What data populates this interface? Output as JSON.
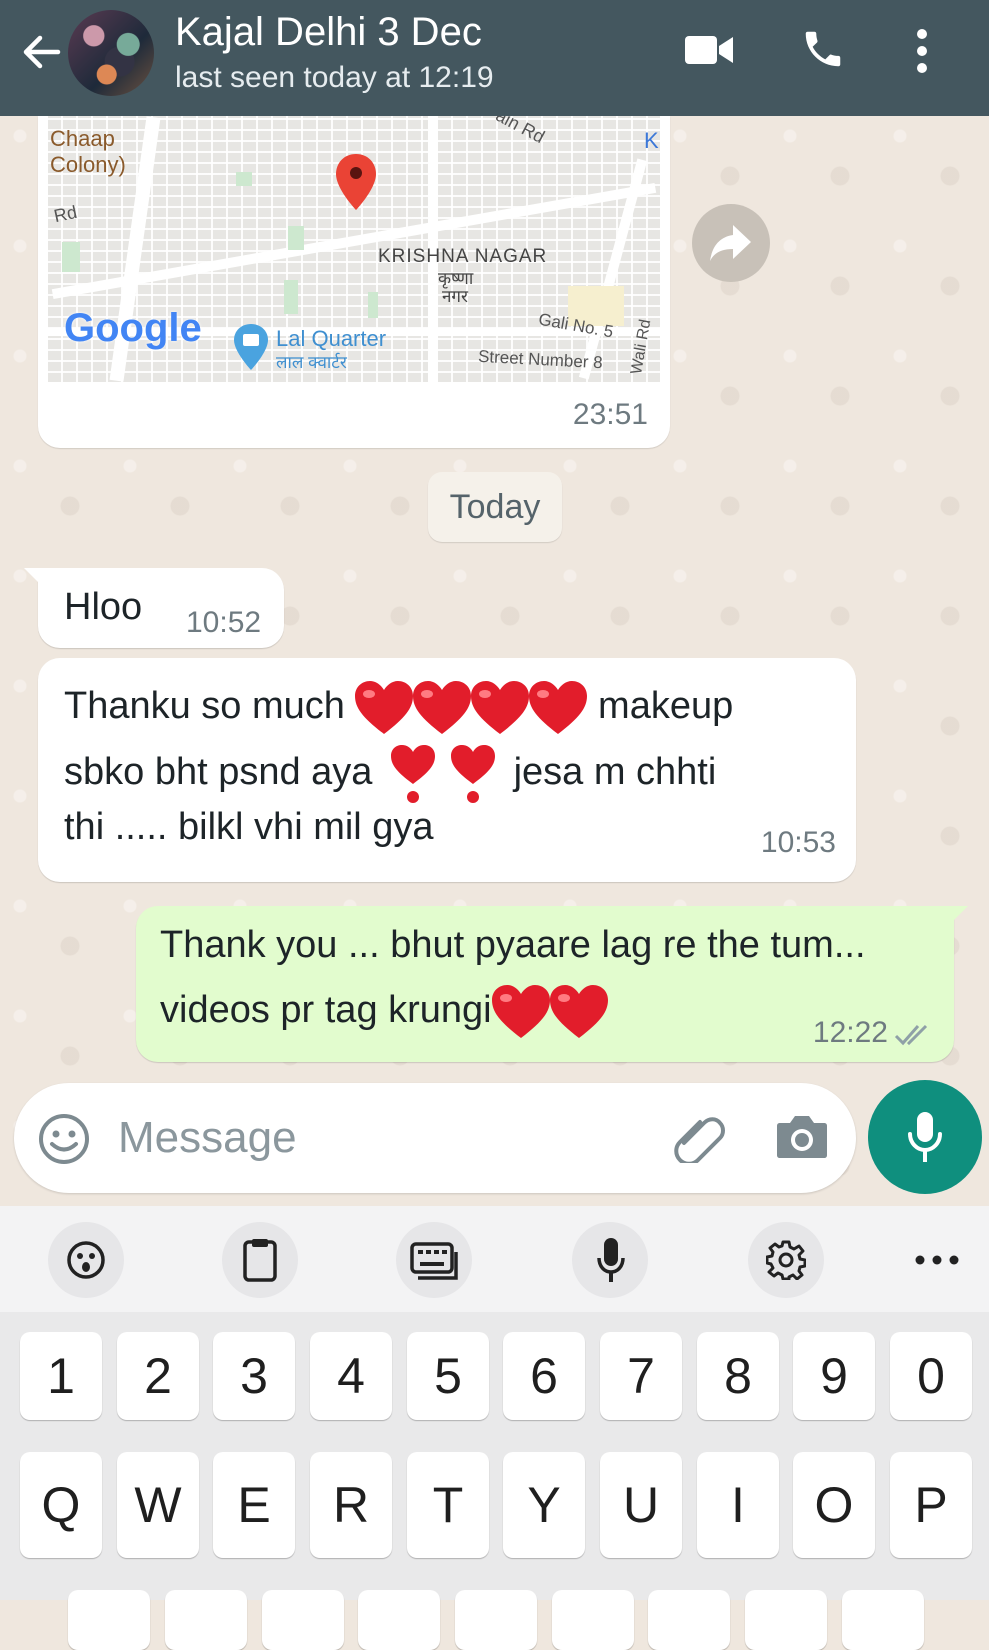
{
  "header": {
    "title": "Kajal Delhi 3 Dec",
    "subtitle": "last seen today at 12:19",
    "icons": [
      "back-arrow-icon",
      "video-call-icon",
      "voice-call-icon",
      "more-vert-icon"
    ],
    "background": "#44575f"
  },
  "map_message": {
    "labels": {
      "chaap": "Chaap",
      "colony": "Colony)",
      "rd_left": "Rd",
      "main_rd": "ain Rd",
      "k": "K",
      "krishna_nagar": "KRISHNA NAGAR",
      "krishna_hindi": "कृष्णा",
      "nagar_hindi": "नगर",
      "google": "Google",
      "lal_quarter": "Lal Quarter",
      "lal_quarter_hindi": "लाल क्वार्टर",
      "gali": "Gali No. 5",
      "street": "Street Number 8",
      "wali_rd": "Wali Rd"
    },
    "time": "23:51"
  },
  "date_chip": "Today",
  "messages": [
    {
      "direction": "incoming",
      "text": "Hloo",
      "time": "10:52"
    },
    {
      "direction": "incoming",
      "line1_a": "Thanku so much",
      "line1_b": "makeup",
      "line2_a": "sbko bht psnd aya",
      "line2_b": "jesa m chhti",
      "line3": "thi ..... bilkl vhi mil gya",
      "time": "10:53"
    },
    {
      "direction": "outgoing",
      "line1": "Thank you ... bhut pyaare lag re the tum...",
      "line2": "videos pr tag krungi",
      "time": "12:22",
      "status": "read"
    }
  ],
  "composer": {
    "placeholder": "Message",
    "icons": [
      "emoji-icon",
      "attach-icon",
      "camera-icon",
      "mic-icon"
    ],
    "accent": "#0f8f7e"
  },
  "keyboard": {
    "toolbar": [
      "emoji-face-icon",
      "clipboard-icon",
      "keyboard-mode-icon",
      "voice-input-icon",
      "settings-gear-icon",
      "more-icon"
    ],
    "number_row": [
      "1",
      "2",
      "3",
      "4",
      "5",
      "6",
      "7",
      "8",
      "9",
      "0"
    ],
    "letter_row": [
      "Q",
      "W",
      "E",
      "R",
      "T",
      "Y",
      "U",
      "I",
      "O",
      "P"
    ]
  }
}
